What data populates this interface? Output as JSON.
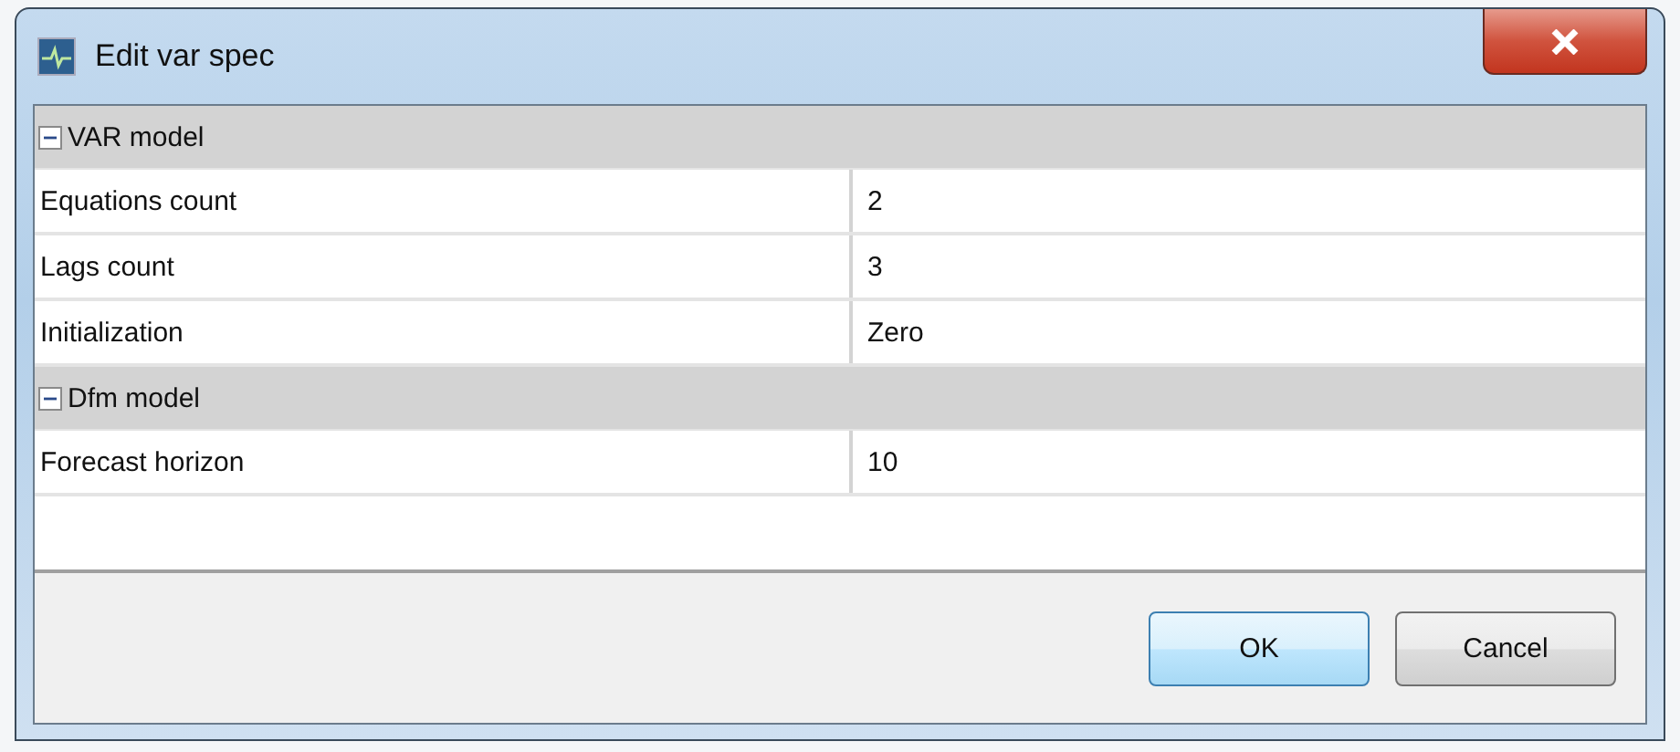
{
  "window": {
    "title": "Edit var spec"
  },
  "property_grid": {
    "categories": [
      {
        "name": "VAR model",
        "expanded": true,
        "properties": [
          {
            "name": "Equations count",
            "value": "2"
          },
          {
            "name": "Lags count",
            "value": "3"
          },
          {
            "name": "Initialization",
            "value": "Zero"
          }
        ]
      },
      {
        "name": "Dfm model",
        "expanded": true,
        "properties": [
          {
            "name": "Forecast horizon",
            "value": "10"
          }
        ]
      }
    ]
  },
  "buttons": [
    {
      "label": "OK",
      "default": true
    },
    {
      "label": "Cancel",
      "default": false
    }
  ]
}
